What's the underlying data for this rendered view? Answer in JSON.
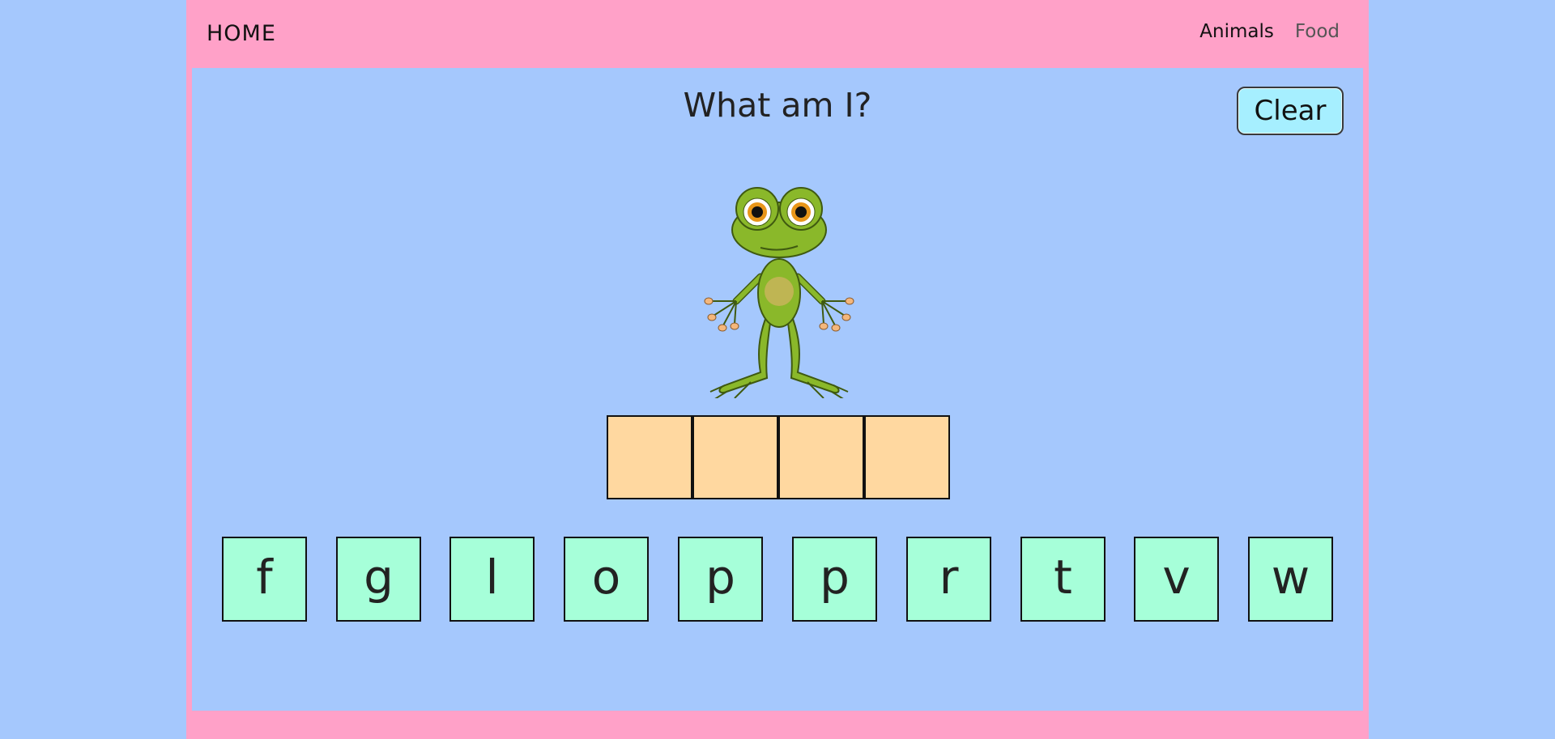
{
  "nav": {
    "home": "HOME",
    "links": [
      "Animals",
      "Food"
    ]
  },
  "game": {
    "title": "What am I?",
    "clear_label": "Clear",
    "image_icon": "frog-icon",
    "slot_count": 4,
    "letters": [
      "f",
      "g",
      "l",
      "o",
      "p",
      "p",
      "r",
      "t",
      "v",
      "w"
    ]
  },
  "colors": {
    "page_bg": "#a5c8fd",
    "frame": "#ffa1c8",
    "slot": "#ffd8a0",
    "tile": "#a6ffd9",
    "clear_button": "#a6efff"
  }
}
